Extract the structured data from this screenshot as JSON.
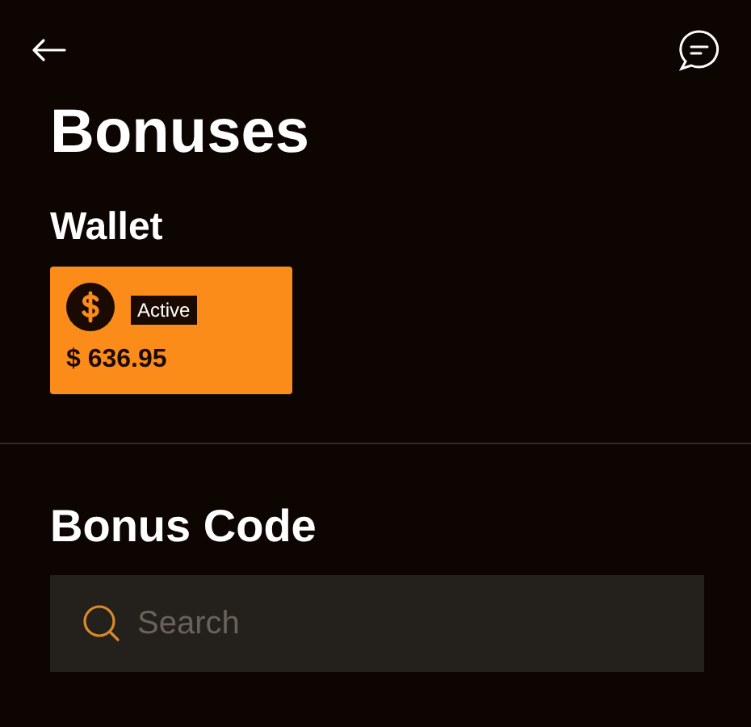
{
  "header": {
    "title": "Bonuses"
  },
  "wallet": {
    "heading": "Wallet",
    "card": {
      "badge": "Active",
      "amount": "$ 636.95"
    }
  },
  "bonus_code": {
    "heading": "Bonus Code",
    "search": {
      "placeholder": "Search"
    }
  }
}
